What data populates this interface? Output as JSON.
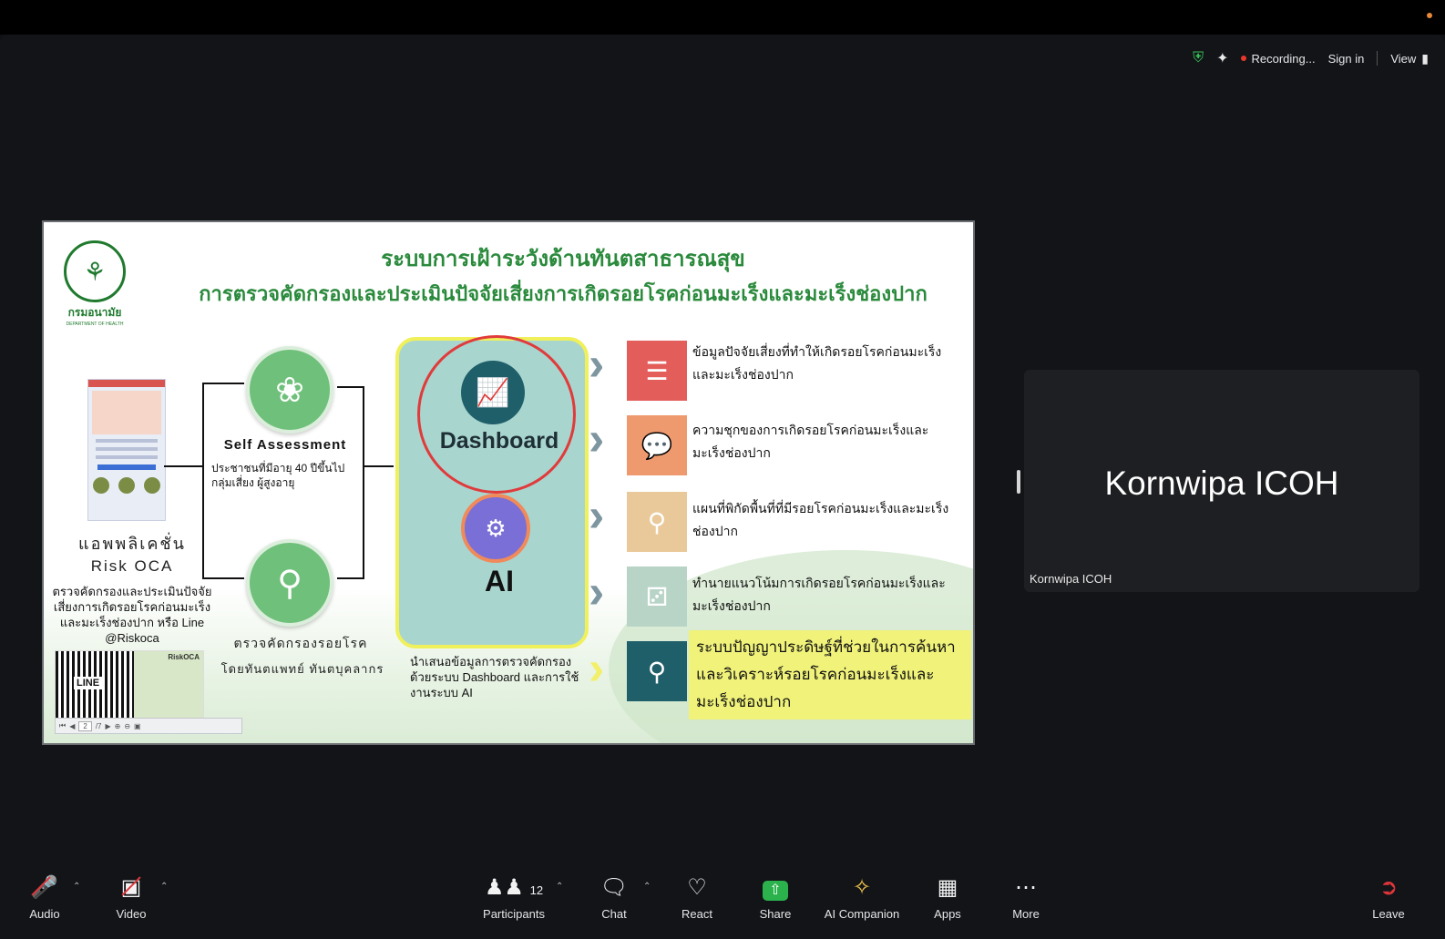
{
  "status": {
    "recording": "Recording...",
    "sign_in": "Sign in",
    "view": "View"
  },
  "slide": {
    "title_line1": "ระบบการเฝ้าระวังด้านทันตสาธารณสุข",
    "title_line2": "การตรวจคัดกรองและประเมินปัจจัยเสี่ยงการเกิดรอยโรคก่อนมะเร็งและมะเร็งช่องปาก",
    "logo_name": "กรมอนามัย",
    "logo_sub": "DEPARTMENT OF HEALTH",
    "app_title": "แอพพลิเคชั่น",
    "app_name": "Risk OCA",
    "app_desc": "ตรวจคัดกรองและประเมินปัจจัยเสี่ยงการเกิดรอยโรคก่อนมะเร็งและมะเร็งช่องปาก หรือ Line @Riskoca",
    "qr_label": "LINE",
    "qr_brand": "RiskOCA",
    "pdf_page": "2",
    "pdf_total": "/7",
    "self_assessment_title": "Self Assessment",
    "self_assessment_desc": "ประชาชนที่มีอายุ 40 ปีขึ้นไป กลุ่มเสี่ยง ผู้สูงอายุ",
    "screening_title": "ตรวจคัดกรองรอยโรค",
    "screening_desc": "โดยทันตแพทย์ ทันตบุคลากร",
    "dashboard_label": "Dashboard",
    "ai_label": "AI",
    "present_desc": "นำเสนอข้อมูลการตรวจคัดกรองด้วยระบบ Dashboard และการใช้งานระบบ AI",
    "items": [
      {
        "text": "ข้อมูลปัจจัยเสี่ยงที่ทำให้เกิดรอยโรคก่อนมะเร็งและมะเร็งช่องปาก",
        "color": "#e35d5b"
      },
      {
        "text": "ความชุกของการเกิดรอยโรคก่อนมะเร็งและมะเร็งช่องปาก",
        "color": "#ee9a6e"
      },
      {
        "text": "แผนที่พิกัดพื้นที่ที่มีรอยโรคก่อนมะเร็งและมะเร็งช่องปาก",
        "color": "#e9c99a"
      },
      {
        "text": "ทำนายแนวโน้มการเกิดรอยโรคก่อนมะเร็งและมะเร็งช่องปาก",
        "color": "#b7d4c6"
      }
    ],
    "highlight_text": "ระบบปัญญาประดิษฐ์ที่ช่วยในการค้นหาและวิเคราะห์รอยโรคก่อนมะเร็งและมะเร็งช่องปาก",
    "highlight_color": "#1f5f6a"
  },
  "participant": {
    "name": "Kornwipa ICOH",
    "label": "Kornwipa ICOH"
  },
  "toolbar": {
    "audio": "Audio",
    "video": "Video",
    "participants": "Participants",
    "participants_count": "12",
    "chat": "Chat",
    "react": "React",
    "share": "Share",
    "ai_companion": "AI Companion",
    "apps": "Apps",
    "more": "More",
    "leave": "Leave"
  }
}
